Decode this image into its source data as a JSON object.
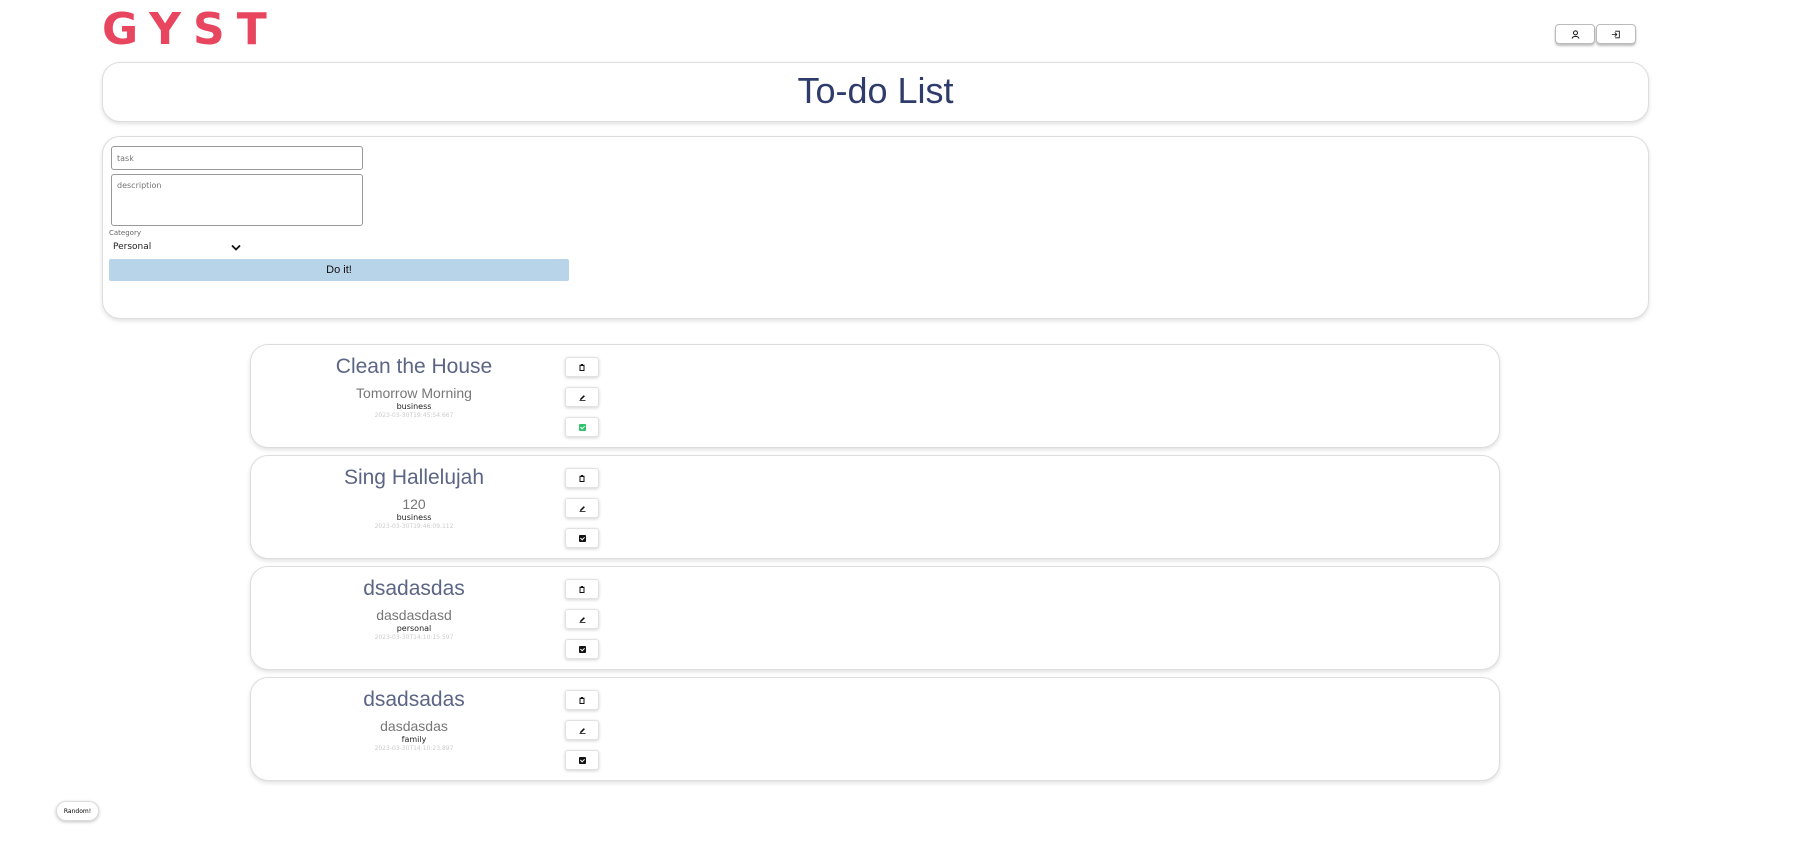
{
  "app": {
    "logo": "GYST"
  },
  "header": {
    "title": "To-do List"
  },
  "form": {
    "task_placeholder": "task",
    "description_placeholder": "description",
    "category_label": "Category",
    "category_selected": "Personal",
    "submit_label": "Do it!"
  },
  "tasks": [
    {
      "title": "Clean the House",
      "description": "Tomorrow Morning",
      "category": "business",
      "timestamp": "2023-03-30T19:45:54.667",
      "completed": true
    },
    {
      "title": "Sing Hallelujah",
      "description": "120",
      "category": "business",
      "timestamp": "2023-03-30T19:46:09.112",
      "completed": false
    },
    {
      "title": "dsadasdas",
      "description": "dasdasdasd",
      "category": "personal",
      "timestamp": "2023-03-30T14:10:15.597",
      "completed": false
    },
    {
      "title": "dsadsadas",
      "description": "dasdasdas",
      "category": "family",
      "timestamp": "2023-03-30T14:10:23.897",
      "completed": false
    }
  ],
  "footer": {
    "random_label": "Random!"
  },
  "colors": {
    "brand": "#e8455f",
    "title": "#2f3b6b",
    "button": "#b8d4e8",
    "done": "#2fc46a"
  },
  "icons": [
    "user-icon",
    "logout-icon",
    "delete-icon",
    "edit-icon",
    "check-icon",
    "chevron-down-icon"
  ]
}
